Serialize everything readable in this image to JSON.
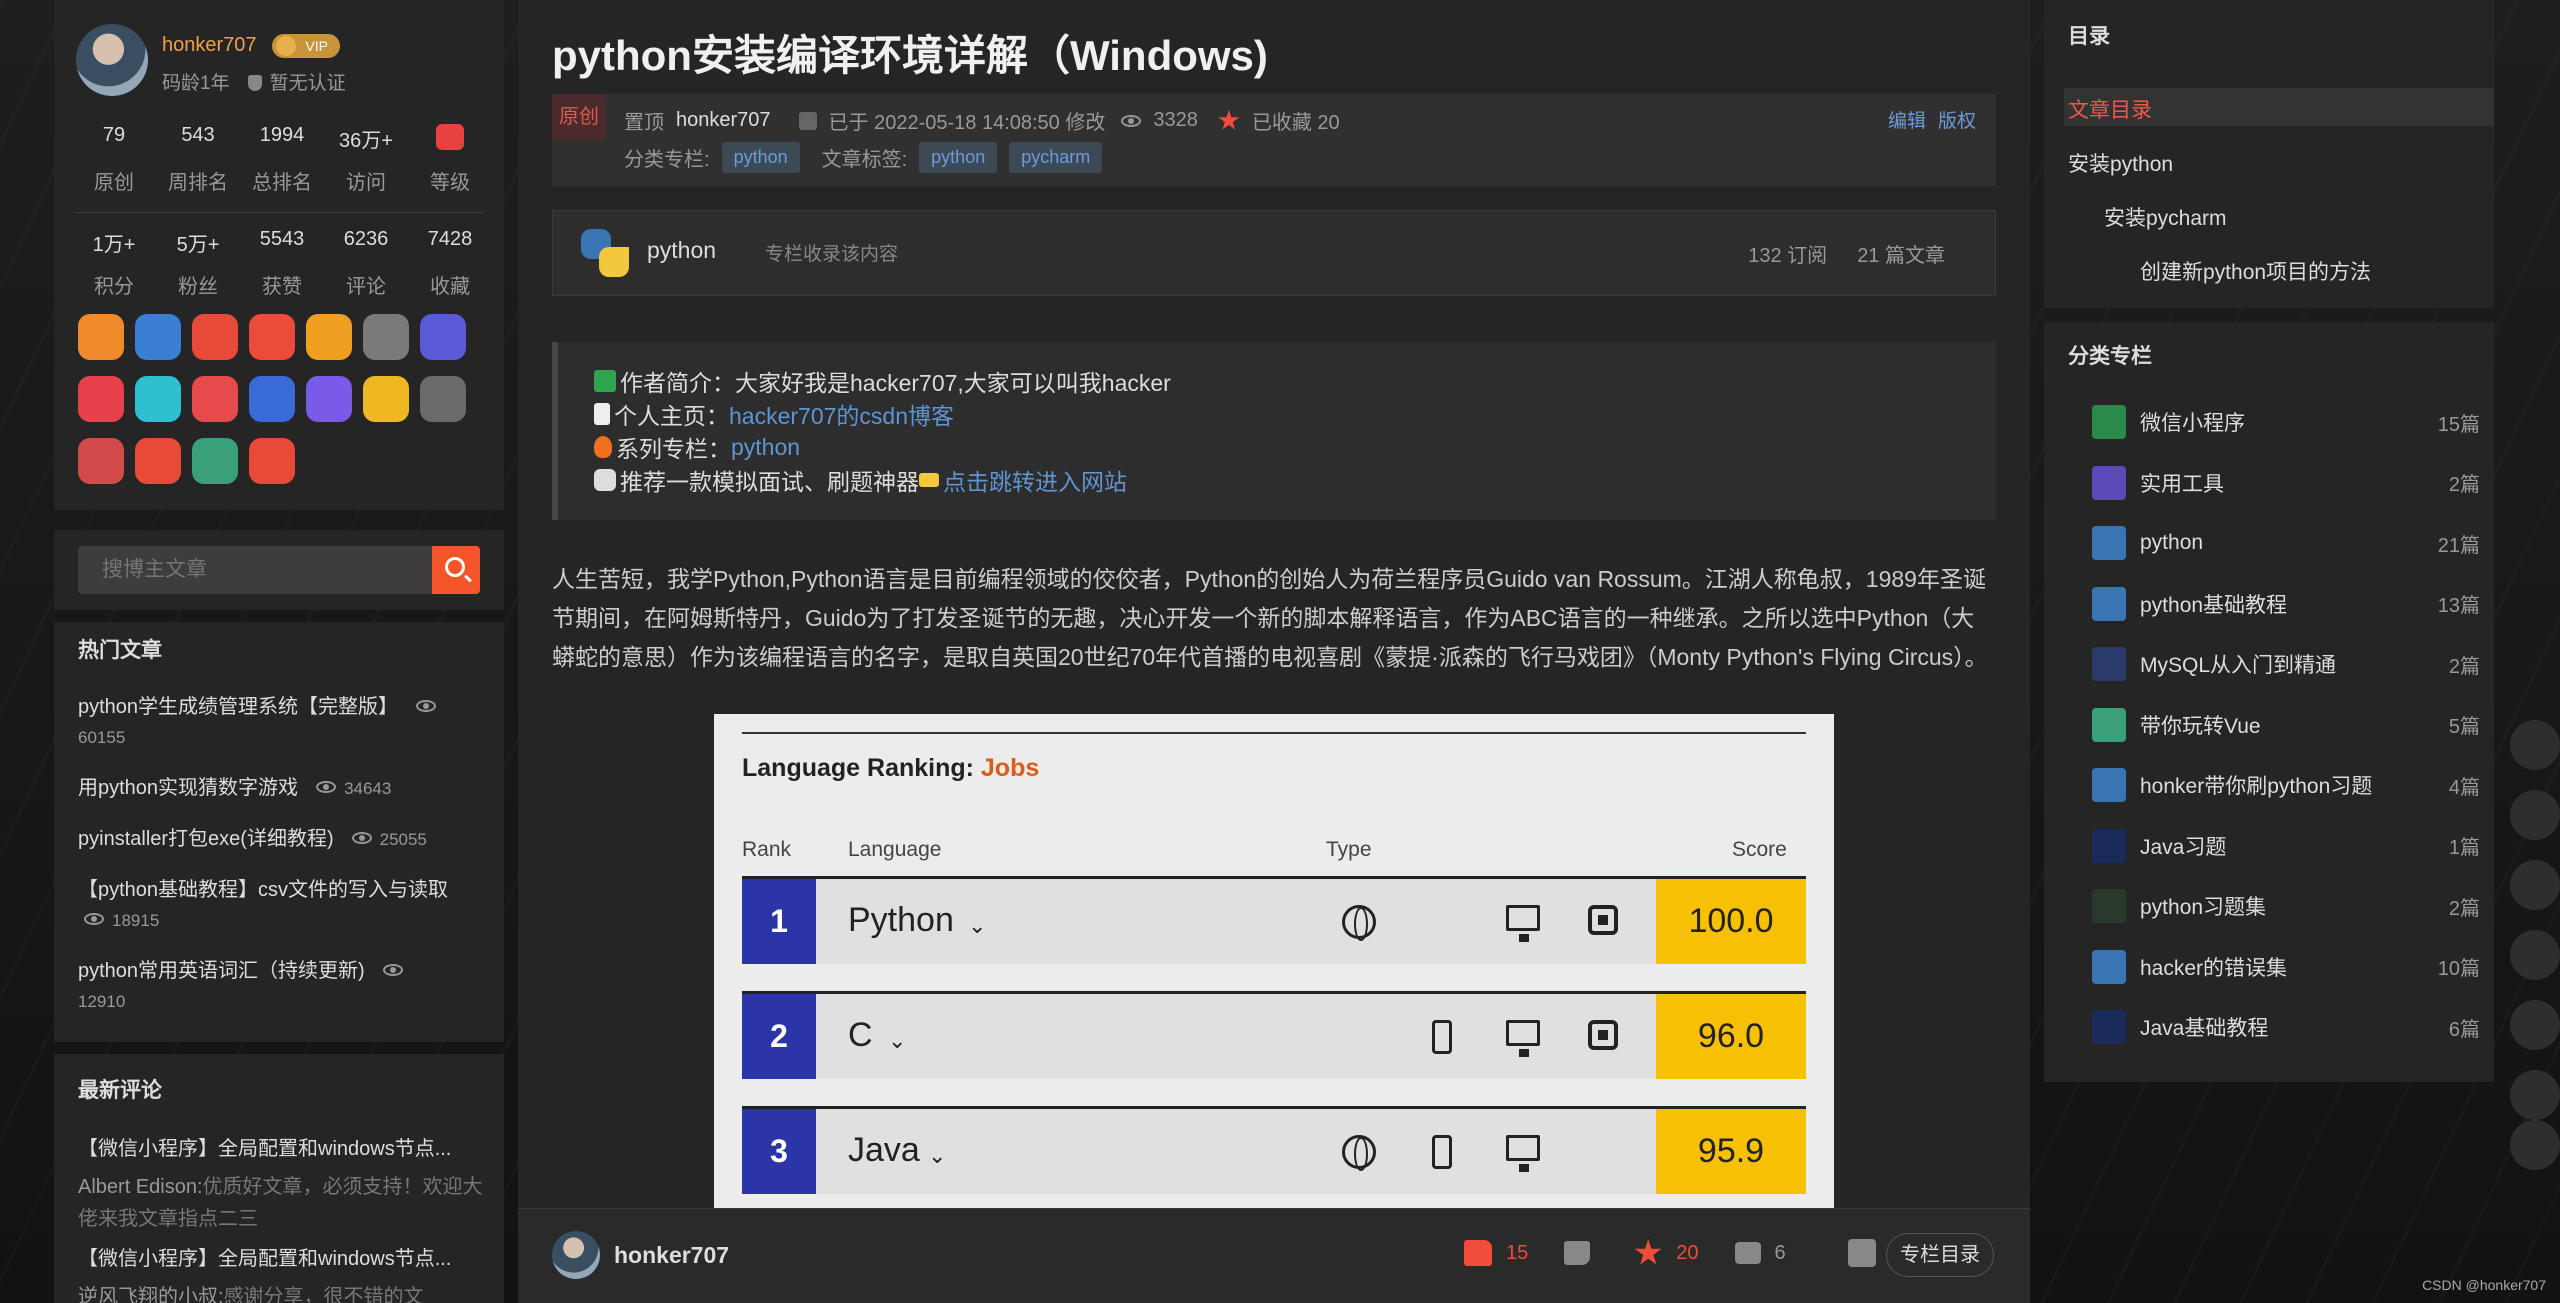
{
  "profile": {
    "username": "honker707",
    "vip": "VIP",
    "age": "码龄1年",
    "cert": "暂无认证",
    "stats1": [
      {
        "num": "79",
        "label": "原创"
      },
      {
        "num": "543",
        "label": "周排名"
      },
      {
        "num": "1994",
        "label": "总排名"
      },
      {
        "num": "36万+",
        "label": "访问"
      },
      {
        "num": "",
        "label": "等级"
      }
    ],
    "stats2": [
      {
        "num": "1万+",
        "label": "积分"
      },
      {
        "num": "5万+",
        "label": "粉丝"
      },
      {
        "num": "5543",
        "label": "获赞"
      },
      {
        "num": "6236",
        "label": "评论"
      },
      {
        "num": "7428",
        "label": "收藏"
      }
    ],
    "badge_colors": [
      "#f08a2a",
      "#3a7fd3",
      "#e84a3a",
      "#ea4b3b",
      "#f0a020",
      "#7a7a7a",
      "#5a5ad8",
      "#e8414b",
      "#2fc0d0",
      "#e74a4a",
      "#3a6ad8",
      "#7a5ae8",
      "#f0b820",
      "#6a6a6a",
      "#d24a4a",
      "#e84a3a",
      "#3aa07a",
      "#e84a3a"
    ]
  },
  "search": {
    "placeholder": "搜博主文章"
  },
  "hot": {
    "title": "热门文章",
    "items": [
      {
        "title": "python学生成绩管理系统【完整版】",
        "views": "60155"
      },
      {
        "title": "用python实现猜数字游戏",
        "views": "34643"
      },
      {
        "title": "pyinstaller打包exe(详细教程)",
        "views": "25055"
      },
      {
        "title": "【python基础教程】csv文件的写入与读取",
        "views": "18915"
      },
      {
        "title": "python常用英语词汇（持续更新)",
        "views": "12910"
      }
    ]
  },
  "comments": {
    "title": "最新评论",
    "items": [
      {
        "title": "【微信小程序】全局配置和windows节点...",
        "user": "Albert Edison:",
        "text": "优质好文章，必须支持！欢迎大佬来我文章指点二三"
      },
      {
        "title": "【微信小程序】全局配置和windows节点...",
        "user": "逆风飞翔的小叔:",
        "text": "感谢分享，很不错的文"
      }
    ]
  },
  "article": {
    "title": "python安装编译环境详解（Windows)",
    "orig": "原创",
    "top": "置顶",
    "author": "honker707",
    "modified": "已于 2022-05-18 14:08:50 修改",
    "views": "3328",
    "collected": "已收藏 20",
    "edit": "编辑",
    "copyright": "版权",
    "column_label": "分类专栏:",
    "column_tag": "python",
    "tag_label": "文章标签:",
    "tags": [
      "python",
      "pycharm"
    ],
    "colbox": {
      "name": "python",
      "note": "专栏收录该内容",
      "subs": "132 订阅",
      "count": "21 篇文章"
    },
    "intro": [
      {
        "text": "作者简介：大家好我是hacker707,大家可以叫我hacker",
        "link": ""
      },
      {
        "text": "个人主页：",
        "link": "hacker707的csdn博客"
      },
      {
        "text": "系列专栏：",
        "link": "python"
      },
      {
        "text": "推荐一款模拟面试、刷题神器",
        "link": "点击跳转进入网站"
      }
    ],
    "para": "人生苦短，我学Python,Python语言是目前编程领域的佼佼者，Python的创始人为荷兰程序员Guido van Rossum。江湖人称龟叔，1989年圣诞节期间，在阿姆斯特丹，Guido为了打发圣诞节的无趣，决心开发一个新的脚本解释语言，作为ABC语言的一种继承。之所以选中Python（大蟒蛇的意思）作为该编程语言的名字，是取自英国20世纪70年代首播的电视喜剧《蒙提·派森的飞行马戏团》（Monty Python's Flying Circus）。"
  },
  "ranking": {
    "title_a": "Language Ranking: ",
    "title_b": "Jobs",
    "headers": {
      "rank": "Rank",
      "language": "Language",
      "type": "Type",
      "score": "Score"
    },
    "rows": [
      {
        "rank": "1",
        "lang": "Python",
        "score": "100.0",
        "icons": [
          "globe-icon",
          "monitor-icon",
          "chip-icon"
        ]
      },
      {
        "rank": "2",
        "lang": "C",
        "score": "96.0",
        "icons": [
          "mobile-icon",
          "monitor-icon",
          "chip-icon"
        ]
      },
      {
        "rank": "3",
        "lang": "Java",
        "score": "95.9",
        "icons": [
          "globe-icon",
          "mobile-icon",
          "monitor-icon"
        ]
      }
    ]
  },
  "toolbar": {
    "name": "honker707",
    "likes": "15",
    "stars": "20",
    "comments": "6",
    "column_btn": "专栏目录"
  },
  "toc": {
    "title": "目录",
    "items": [
      "文章目录",
      "安装python",
      "安装pycharm",
      "创建新python项目的方法"
    ]
  },
  "cats": {
    "title": "分类专栏",
    "items": [
      {
        "name": "微信小程序",
        "count": "15篇",
        "color": "#2a8a4a"
      },
      {
        "name": "实用工具",
        "count": "2篇",
        "color": "#5a4ab8"
      },
      {
        "name": "python",
        "count": "21篇",
        "color": "#3b74b3"
      },
      {
        "name": "python基础教程",
        "count": "13篇",
        "color": "#3b74b3"
      },
      {
        "name": "MySQL从入门到精通",
        "count": "2篇",
        "color": "#2a3a6a"
      },
      {
        "name": "带你玩转Vue",
        "count": "5篇",
        "color": "#3aa07a"
      },
      {
        "name": "honker带你刷python习题",
        "count": "4篇",
        "color": "#3b74b3"
      },
      {
        "name": "Java习题",
        "count": "1篇",
        "color": "#1a2a5a"
      },
      {
        "name": "python习题集",
        "count": "2篇",
        "color": "#2a3a2a"
      },
      {
        "name": "hacker的错误集",
        "count": "10篇",
        "color": "#3b74b3"
      },
      {
        "name": "Java基础教程",
        "count": "6篇",
        "color": "#1a2a5a"
      }
    ]
  },
  "watermark": "CSDN @honker707"
}
